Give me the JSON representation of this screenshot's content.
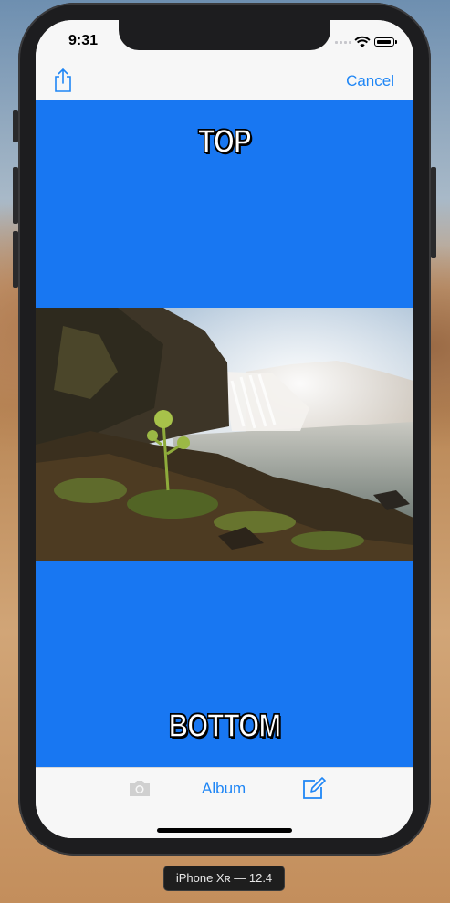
{
  "status_bar": {
    "time": "9:31"
  },
  "nav_bar": {
    "share_icon": "share-icon",
    "cancel_label": "Cancel"
  },
  "meme": {
    "top_text": "TOP",
    "bottom_text": "BOTTOM",
    "background_color": "#1877f2",
    "image": "waterfall landscape photo"
  },
  "toolbar": {
    "camera_icon": "camera-icon",
    "album_label": "Album",
    "edit_icon": "compose-icon"
  },
  "simulator": {
    "device_label": "iPhone Xʀ — 12.4"
  },
  "colors": {
    "accent": "#1f86f5",
    "canvas": "#1877f2"
  }
}
